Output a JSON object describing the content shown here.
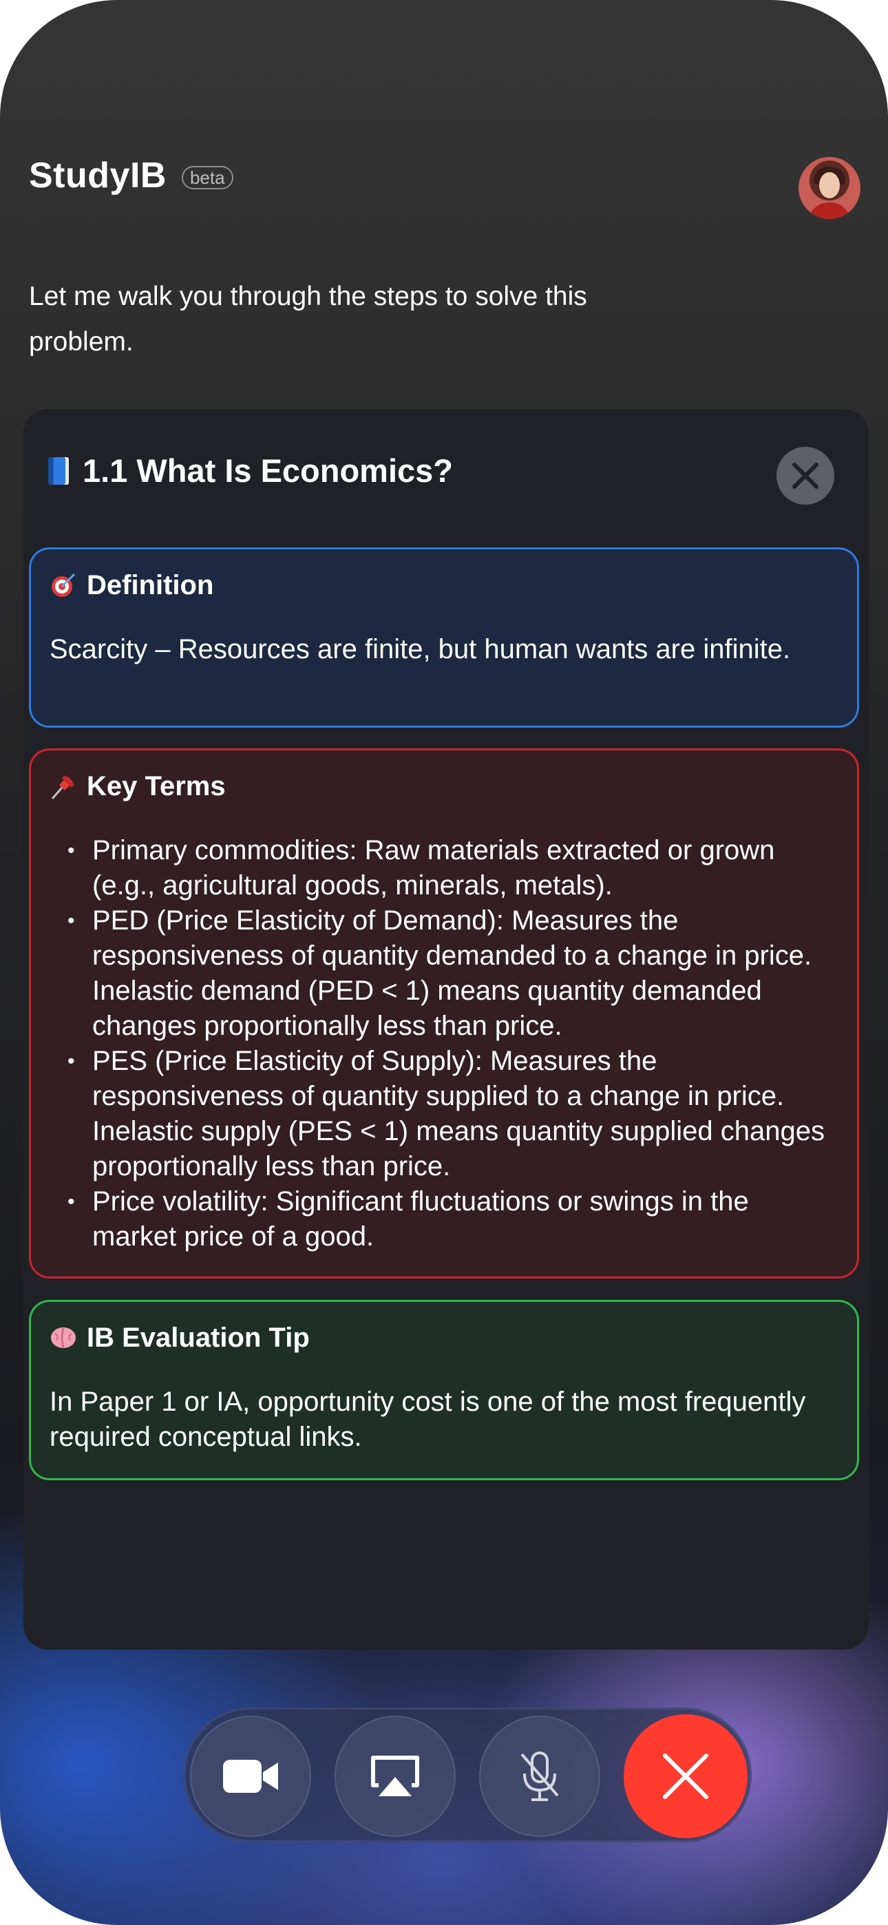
{
  "app": {
    "title": "StudyIB",
    "badge": "beta"
  },
  "user": {
    "avatar_alt": "user-avatar"
  },
  "message": {
    "intro": "Let me walk you through the steps to solve this problem."
  },
  "panel": {
    "title": "1.1 What Is Economics?",
    "title_icon": "book-icon",
    "close_icon": "close-icon"
  },
  "cards": {
    "definition": {
      "icon": "target-icon",
      "heading": "Definition",
      "text": "Scarcity – Resources are finite, but human wants are infinite.",
      "color": "#2f7ae3"
    },
    "key_terms": {
      "icon": "pushpin-icon",
      "heading": "Key Terms",
      "color": "#c9262b",
      "items": [
        "Primary commodities: Raw materials extracted or grown (e.g., agricultural goods, minerals, metals).",
        "PED (Price Elasticity of Demand): Measures the responsiveness of quantity demanded to a change in price. Inelastic demand (PED < 1) means quantity demanded changes proportionally less than price.",
        "PES (Price Elasticity of Supply): Measures the responsiveness of quantity supplied to a change in price. Inelastic supply (PES < 1) means quantity supplied changes proportionally less than price.",
        "Price volatility: Significant fluctuations or swings in the market price of a good."
      ]
    },
    "tip": {
      "icon": "brain-icon",
      "heading": "IB Evaluation Tip",
      "text": "In Paper 1 or IA, opportunity cost is one of the most frequently required conceptual links.",
      "color": "#32b64c"
    }
  },
  "call_controls": {
    "video_icon": "video-camera-icon",
    "airplay_icon": "airplay-icon",
    "mic_icon": "microphone-muted-icon",
    "end_icon": "end-call-icon",
    "end_color": "#ff3b30"
  }
}
